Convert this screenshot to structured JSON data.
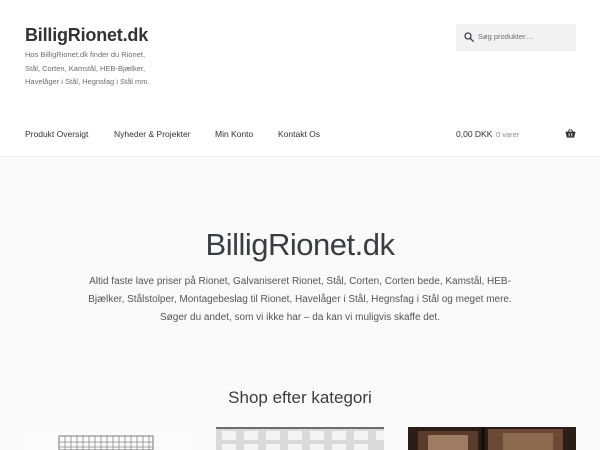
{
  "site": {
    "title": "BilligRionet.dk",
    "tagline": "Hos BilligRionet.dk finder du Rionet, Stål, Corten, Kamstål, HEB-Bjælker, Havelåger i Stål, Hegnsfag i Stål mm."
  },
  "search": {
    "placeholder": "Søg produkter…",
    "icon": "search-icon"
  },
  "nav": {
    "items": [
      {
        "label": "Produkt Oversigt"
      },
      {
        "label": "Nyheder & Projekter"
      },
      {
        "label": "Min Konto"
      },
      {
        "label": "Kontakt Os"
      }
    ]
  },
  "cart": {
    "amount": "0,00 DKK",
    "count": "0 varer",
    "icon": "basket-icon"
  },
  "hero": {
    "title": "BilligRionet.dk",
    "description": "Altid faste lave priser på Rionet, Galvaniseret Rionet, Stål, Corten, Corten bede, Kamstål, HEB-Bjælker, Stålstolper, Montagebeslag til Rionet, Havelåger i Stål, Hegnsfag i Stål og meget mere. Søger du andet, som vi ikke har – da kan vi muligvis skaffe det."
  },
  "shop": {
    "title": "Shop efter kategori"
  },
  "colors": {
    "hero_background": "#fafafa",
    "text": "#43454b"
  }
}
